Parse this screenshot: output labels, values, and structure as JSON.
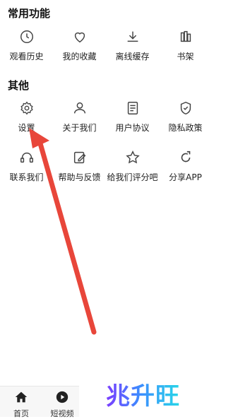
{
  "common": {
    "title": "常用功能",
    "items": [
      {
        "label": "观看历史",
        "icon": "clock-icon"
      },
      {
        "label": "我的收藏",
        "icon": "heart-icon"
      },
      {
        "label": "离线缓存",
        "icon": "download-icon"
      },
      {
        "label": "书架",
        "icon": "bookshelf-icon"
      }
    ]
  },
  "other": {
    "title": "其他",
    "items": [
      {
        "label": "设置",
        "icon": "gear-icon"
      },
      {
        "label": "关于我们",
        "icon": "users-icon"
      },
      {
        "label": "用户协议",
        "icon": "document-icon"
      },
      {
        "label": "隐私政策",
        "icon": "shield-icon"
      },
      {
        "label": "联系我们",
        "icon": "headset-icon"
      },
      {
        "label": "帮助与反馈",
        "icon": "edit-icon"
      },
      {
        "label": "给我们评分吧",
        "icon": "star-icon"
      },
      {
        "label": "分享APP",
        "icon": "share-icon"
      }
    ]
  },
  "bottom_nav": [
    {
      "label": "首页",
      "icon": "home-icon"
    },
    {
      "label": "短视频",
      "icon": "play-icon"
    }
  ],
  "watermark": "兆升旺",
  "colors": {
    "annotation_arrow": "#e8463a",
    "text": "#222222"
  }
}
